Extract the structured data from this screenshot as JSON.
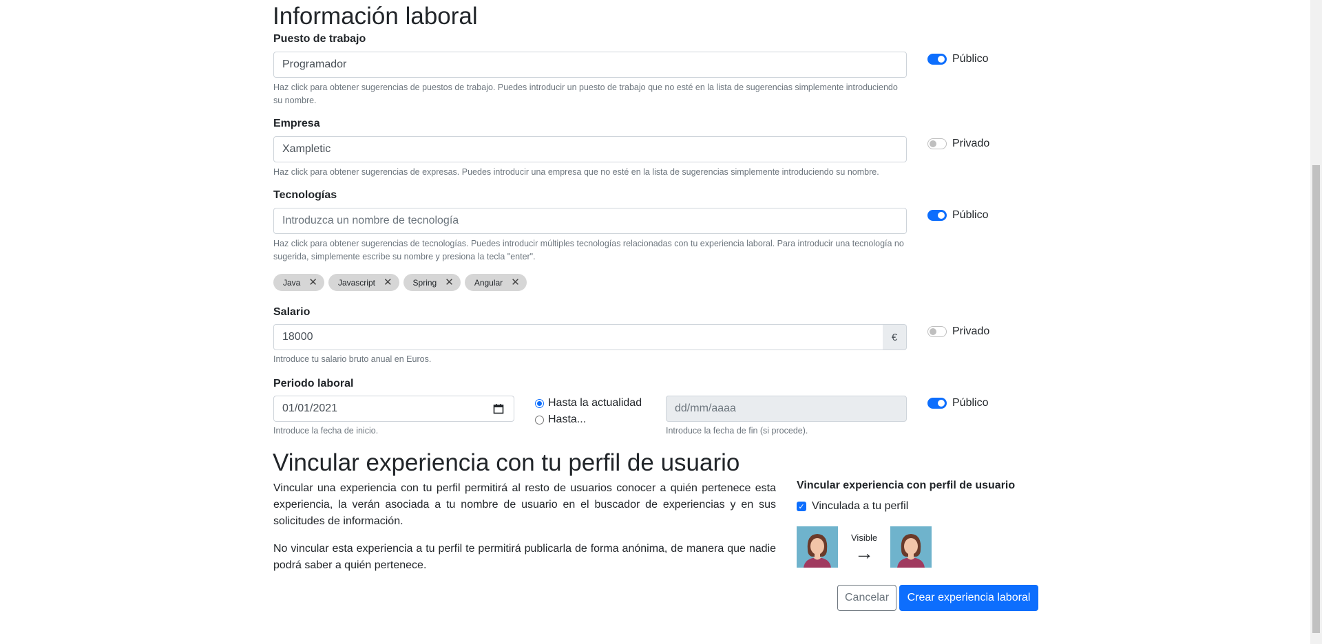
{
  "section1": {
    "title": "Información laboral"
  },
  "job": {
    "label": "Puesto de trabajo",
    "value": "Programador",
    "help": "Haz click para obtener sugerencias de puestos de trabajo. Puedes introducir un puesto de trabajo que no esté en la lista de sugerencias simplemente introduciendo su nombre.",
    "visibility": "Público"
  },
  "company": {
    "label": "Empresa",
    "value": "Xampletic",
    "help": "Haz click para obtener sugerencias de expresas. Puedes introducir una empresa que no esté en la lista de sugerencias simplemente introduciendo su nombre.",
    "visibility": "Privado"
  },
  "tech": {
    "label": "Tecnologías",
    "placeholder": "Introduzca un nombre de tecnología",
    "help": "Haz click para obtener sugerencias de tecnologías. Puedes introducir múltiples tecnologías relacionadas con tu experiencia laboral. Para introducir una tecnología no sugerida, simplemente escribe su nombre y presiona la tecla \"enter\".",
    "visibility": "Público",
    "tags": [
      "Java",
      "Javascript",
      "Spring",
      "Angular"
    ],
    "tag_remove": "✕"
  },
  "salary": {
    "label": "Salario",
    "value": "18000",
    "currency": "€",
    "help": "Introduce tu salario bruto anual en Euros.",
    "visibility": "Privado"
  },
  "period": {
    "label": "Periodo laboral",
    "start_value": "01/01/2021",
    "start_help": "Introduce la fecha de inicio.",
    "radio_current": "Hasta la actualidad",
    "radio_until": "Hasta...",
    "end_placeholder": "dd/mm/aaaa",
    "end_help": "Introduce la fecha de fin (si procede).",
    "visibility": "Público"
  },
  "section2": {
    "title": "Vincular experiencia con tu perfil de usuario",
    "para1": "Vincular una experiencia con tu perfil permitirá al resto de usuarios conocer a quién pertenece esta experiencia, la verán asociada a tu nombre de usuario en el buscador de experiencias y en sus solicitudes de información.",
    "para2": "No vincular esta experiencia a tu perfil te permitirá publicarla de forma anónima, de manera que nadie podrá saber a quién pertenece."
  },
  "link": {
    "title": "Vincular experiencia con perfil de usuario",
    "checkbox_label": "Vinculada a tu perfil",
    "visible_label": "Visible",
    "arrow": "→"
  },
  "buttons": {
    "cancel": "Cancelar",
    "submit": "Crear experiencia laboral"
  },
  "colors": {
    "primary": "#0d6efd",
    "avatar_bg": "#6fb3cc"
  }
}
